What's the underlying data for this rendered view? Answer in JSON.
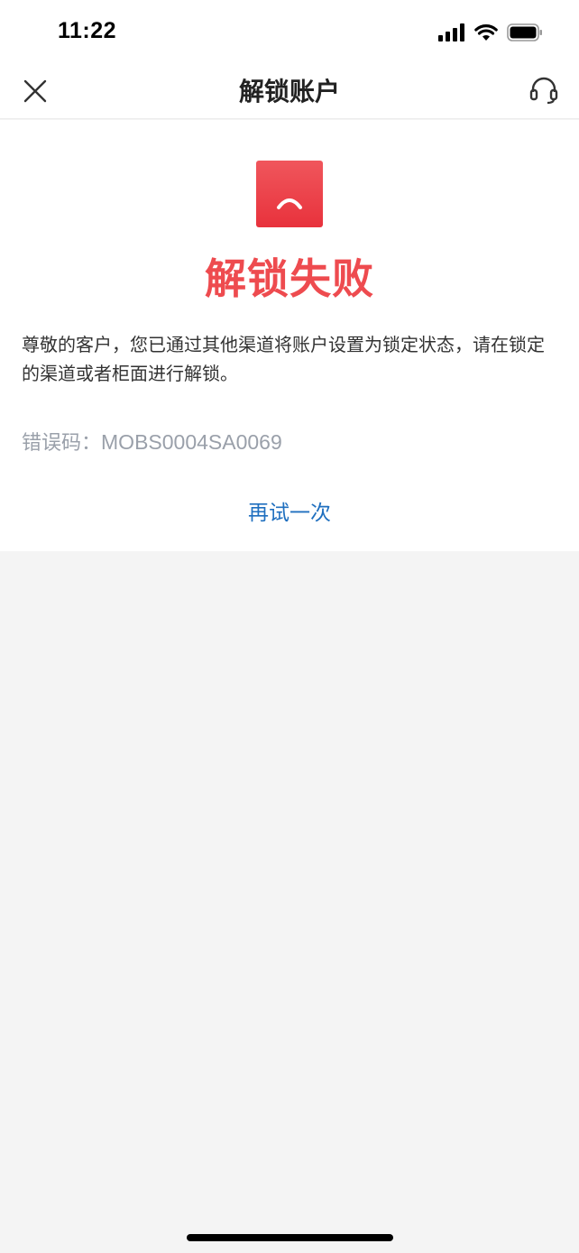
{
  "status_bar": {
    "time": "11:22",
    "icons": [
      "cellular-signal-icon",
      "wifi-icon",
      "battery-icon"
    ]
  },
  "nav": {
    "title": "解锁账户",
    "left_icon": "close-icon",
    "right_icon": "headset-support-icon"
  },
  "result": {
    "icon": "sad-face-icon",
    "title": "解锁失败",
    "description": "尊敬的客户，您已通过其他渠道将账户设置为锁定状态，请在锁定的渠道或者柜面进行解锁。",
    "error_label": "错误码：",
    "error_code": "MOBS0004SA0069",
    "retry_label": "再试一次"
  },
  "colors": {
    "accent_red": "#ee4b4f",
    "link_blue": "#1f6fbf",
    "muted_gray": "#9aa0aa",
    "background": "#f4f4f4"
  }
}
